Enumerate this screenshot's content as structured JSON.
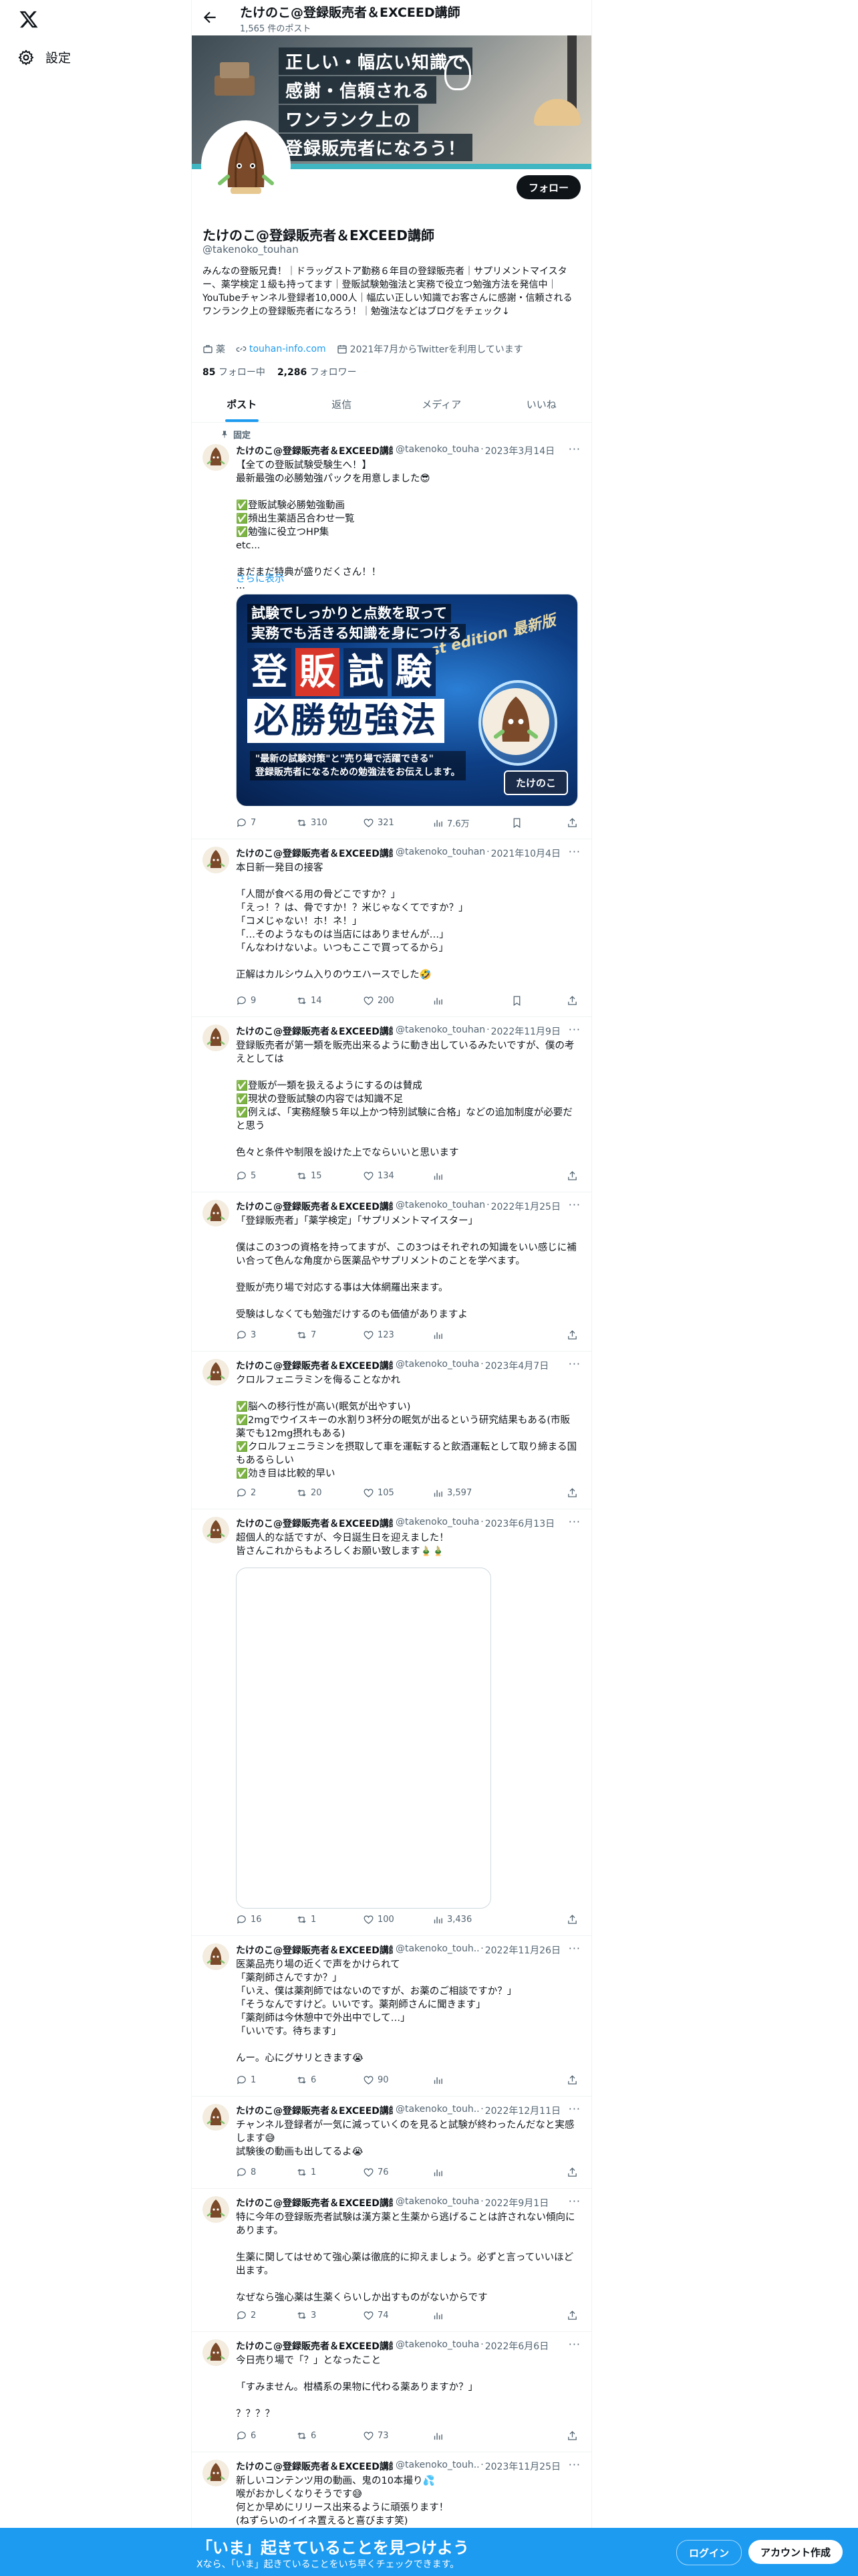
{
  "sidebar": {
    "settings_label": "設定"
  },
  "header": {
    "name": "たけのこ@登録販売者＆EXCEED講師",
    "post_count": "1,565 件のポスト"
  },
  "banner": {
    "lines": [
      "正しい・幅広い知識で",
      "感謝・信頼される",
      "ワンランク上の",
      "登録販売者になろう！"
    ]
  },
  "profile": {
    "follow_label": "フォロー",
    "name": "たけのこ@登録販売者＆EXCEED講師",
    "handle": "@takenoko_touhan",
    "bio": "みんなの登販兄貴！｜ドラッグストア勤務６年目の登録販売者｜サプリメントマイスター、薬学検定１級も持ってます｜登販試験勉強法と実務で役立つ勉強方法を発信中｜YouTubeチャンネル登録者10,000人｜幅広い正しい知識でお客さんに感謝・信頼されるワンランク上の登録販売者になろう！｜勉強法などはブログをチェック↓",
    "category": "薬",
    "website": "touhan-info.com",
    "joined": "2021年7月からTwitterを利用しています",
    "following_count": "85",
    "following_label": "フォロー中",
    "followers_count": "2,286",
    "followers_label": "フォロワー"
  },
  "tabs": [
    "ポスト",
    "返信",
    "メディア",
    "いいね"
  ],
  "pinned_label": "固定",
  "show_more_label": "さらに表示",
  "tweets": [
    {
      "name": "たけのこ@登録販売者＆EXCEED講師",
      "handle": "@takenoko_touha",
      "date": "2023年3月14日",
      "text": "【全ての登販試験受験生へ！】\n最新最強の必勝勉強パックを用意しました😎\n\n✅登販試験必勝勉強動画\n✅頻出生薬語呂合わせ一覧\n✅勉強に役立つHP集\netc...\n\nまだまだ特典が盛りだくさん！！\n...",
      "replies": "7",
      "retweets": "310",
      "likes": "321",
      "views": "7.6万"
    },
    {
      "name": "たけのこ@登録販売者＆EXCEED講師",
      "handle": "@takenoko_touhan",
      "date": "2021年10月4日",
      "text": "本日新一発目の接客\n\n「人間が食べる用の骨どこですか？」\n「えっ！？は、骨ですか！？米じゃなくてですか？」\n「コメじゃない！ホ！ネ！」\n「…そのようなものは当店にはありませんが…」\n「んなわけないよ。いつもここで買ってるから」\n\n正解はカルシウム入りのウエハースでした🤣",
      "replies": "9",
      "retweets": "14",
      "likes": "200",
      "views": ""
    },
    {
      "name": "たけのこ@登録販売者＆EXCEED講師",
      "handle": "@takenoko_touhan",
      "date": "2022年11月9日",
      "text": "登録販売者が第一類を販売出来るように動き出しているみたいですが、僕の考えとしては\n\n✅登販が一類を扱えるようにするのは賛成\n✅現状の登販試験の内容では知識不足\n✅例えば、「実務経験５年以上かつ特別試験に合格」などの追加制度が必要だと思う\n\n色々と条件や制限を設けた上でならいいと思います",
      "replies": "5",
      "retweets": "15",
      "likes": "134",
      "views": ""
    },
    {
      "name": "たけのこ@登録販売者＆EXCEED講師",
      "handle": "@takenoko_touhan",
      "date": "2022年1月25日",
      "text": "「登録販売者」「薬学検定」「サプリメントマイスター」\n\n僕はこの3つの資格を持ってますが、この3つはそれぞれの知識をいい感じに補い合って色んな角度から医薬品やサプリメントのことを学べます。\n\n登販が売り場で対応する事は大体網羅出来ます。\n\n受験はしなくても勉強だけするのも価値がありますよ",
      "replies": "3",
      "retweets": "7",
      "likes": "123",
      "views": ""
    },
    {
      "name": "たけのこ@登録販売者＆EXCEED講師",
      "handle": "@takenoko_touha",
      "date": "2023年4月7日",
      "text": "クロルフェニラミンを侮ることなかれ\n\n✅脳への移行性が高い(眠気が出やすい)\n✅2mgでウイスキーの水割り3杯分の眠気が出るという研究結果もある(市販薬でも12mg摂れもある)\n✅クロルフェニラミンを摂取して車を運転すると飲酒運転として取り締まる国もあるらしい\n✅効き目は比較的早い",
      "replies": "2",
      "retweets": "20",
      "likes": "105",
      "views": "3,597"
    },
    {
      "name": "たけのこ@登録販売者＆EXCEED講師",
      "handle": "@takenoko_touha",
      "date": "2023年6月13日",
      "text": "超個人的な話ですが、今日誕生日を迎えました！\n皆さんこれからもよろしくお願い致します🎍🎍",
      "replies": "16",
      "retweets": "1",
      "likes": "100",
      "views": "3,436"
    },
    {
      "name": "たけのこ@登録販売者＆EXCEED講師",
      "handle": "@takenoko_touh..",
      "date": "2022年11月26日",
      "text": "医薬品売り場の近くで声をかけられて\n「薬剤師さんですか？」\n「いえ、僕は薬剤師ではないのですが、お薬のご相談ですか？」\n「そうなんですけど。いいです。薬剤師さんに聞きます」\n「薬剤師は今休憩中で外出中でして…」\n「いいです。待ちます」\n\nんー。心にグサリときます😭",
      "replies": "1",
      "retweets": "6",
      "likes": "90",
      "views": ""
    },
    {
      "name": "たけのこ@登録販売者＆EXCEED講師",
      "handle": "@takenoko_touh..",
      "date": "2022年12月11日",
      "text": "チャンネル登録者が一気に減っていくのを見ると試験が終わったんだなと実感します😅\n試験後の動画も出してるよ😭",
      "replies": "8",
      "retweets": "1",
      "likes": "76",
      "views": ""
    },
    {
      "name": "たけのこ@登録販売者＆EXCEED講師",
      "handle": "@takenoko_touha",
      "date": "2022年9月1日",
      "text": "特に今年の登録販売者試験は漢方薬と生薬から逃げることは許されない傾向にあります。\n\n生薬に関してはせめて強心薬は徹底的に抑えましょう。必ずと言っていいほど出ます。\n\nなぜなら強心薬は生薬くらいしか出すものがないからです",
      "replies": "2",
      "retweets": "3",
      "likes": "74",
      "views": ""
    },
    {
      "name": "たけのこ@登録販売者＆EXCEED講師",
      "handle": "@takenoko_touha",
      "date": "2022年6月6日",
      "text": "今日売り場で「？」となったこと\n\n「すみません。柑橘系の果物に代わる薬ありますか？」\n\n？？？？",
      "replies": "6",
      "retweets": "6",
      "likes": "73",
      "views": ""
    },
    {
      "name": "たけのこ@登録販売者＆EXCEED講師",
      "handle": "@takenoko_touh..",
      "date": "2023年11月25日",
      "text": "新しいコンテンツ用の動画、鬼の10本撮り💦\n喉がおかしくなりそうです😅\n何とか早めにリリース出来るように頑張ります！\n(ねずらいのイイネ置えると喜びます笑)",
      "replies": "",
      "retweets": "",
      "likes": "",
      "views": ""
    }
  ],
  "promo_image": {
    "line1": "試験でしっかりと点数を取って",
    "line2": "実務でも活きる知識を身につける",
    "big1": [
      "登",
      "販",
      "試",
      "験"
    ],
    "big2": "必勝勉強法",
    "latest": "Latest edition 最新版",
    "sub1": "\"最新の試験対策\"と\"売り場で活躍できる\"",
    "sub2": "登録販売者になるための勉強法をお伝えします。",
    "author": "たけのこ"
  },
  "login_bar": {
    "title": "「いま」起きていることを見つけよう",
    "subtitle": "Xなら、「いま」起きていることをいち早くチェックできます。",
    "login_label": "ログイン",
    "signup_label": "アカウント作成"
  },
  "colors": {
    "accent": "#1d9bf0",
    "text": "#0f1419",
    "muted": "#536471",
    "banner_stripe": "#3fb6c2"
  }
}
